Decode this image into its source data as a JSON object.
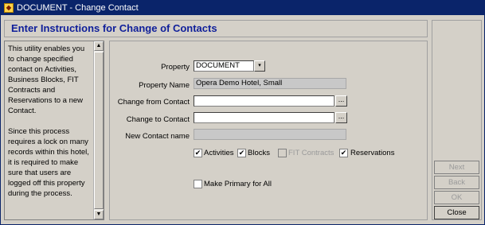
{
  "window": {
    "title": "DOCUMENT - Change Contact"
  },
  "header": {
    "title": "Enter Instructions for Change of Contacts"
  },
  "instructions": {
    "text": "This utility enables you to change specified contact on Activities, Business Blocks, FIT Contracts and Reservations to a new Contact.\n\nSince this process requires a lock on many records within this hotel, it is required to make sure that users are logged off this property during the process."
  },
  "form": {
    "property_label": "Property",
    "property_value": "DOCUMENT",
    "property_name_label": "Property Name",
    "property_name_value": "Opera Demo Hotel, Small",
    "change_from_label": "Change from Contact",
    "change_from_value": "",
    "change_to_label": "Change to Contact",
    "change_to_value": "",
    "new_contact_label": "New Contact name",
    "new_contact_value": ""
  },
  "checkboxes": {
    "activities": {
      "label": "Activities",
      "checked": true
    },
    "blocks": {
      "label": "Blocks",
      "checked": true
    },
    "fit_contracts": {
      "label": "FIT Contracts",
      "checked": false,
      "disabled": true
    },
    "reservations": {
      "label": "Reservations",
      "checked": true
    },
    "make_primary": {
      "label": "Make Primary for All",
      "checked": false
    }
  },
  "buttons": {
    "next": "Next",
    "back": "Back",
    "ok": "OK",
    "close": "Close"
  },
  "icons": {
    "checkmark": "✔",
    "dropdown": "▾",
    "ellipsis": "...",
    "scroll_up": "▲",
    "scroll_down": "▼"
  }
}
